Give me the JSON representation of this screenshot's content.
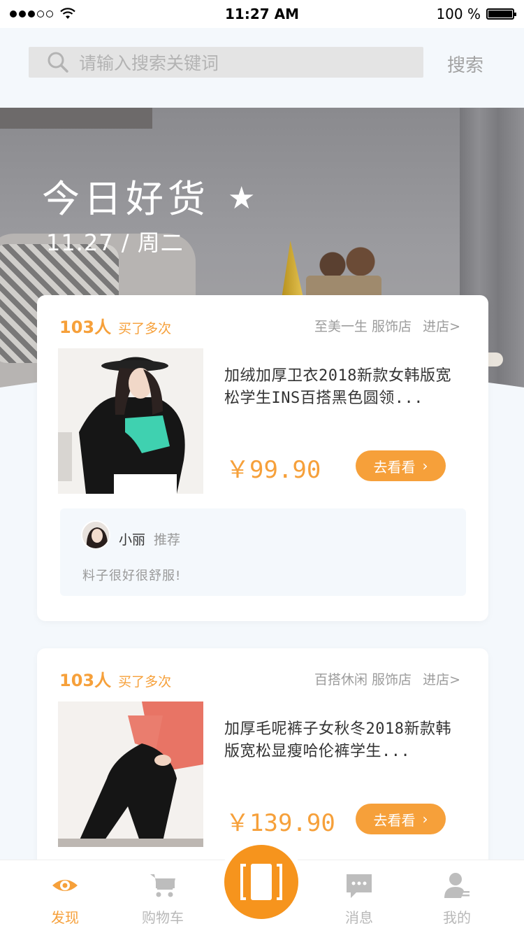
{
  "status": {
    "time": "11:27 AM",
    "battery": "100 %"
  },
  "search": {
    "placeholder": "请输入搜索关键词",
    "button": "搜索"
  },
  "hero": {
    "title": "今日好货",
    "date": "11.27 / 周二"
  },
  "products": [
    {
      "buyers": "103人",
      "buyers_tip": "买了多次",
      "shop": "至美一生 服饰店",
      "enter": "进店>",
      "title": "加绒加厚卫衣2018新款女韩版宽松学生INS百搭黑色圆领...",
      "price": "￥99.90",
      "button": "去看看",
      "recommender": "小丽",
      "recommend_tag": "推荐",
      "comment": "料子很好很舒服!"
    },
    {
      "buyers": "103人",
      "buyers_tip": "买了多次",
      "shop": "百搭休闲 服饰店",
      "enter": "进店>",
      "title": "加厚毛呢裤子女秋冬2018新款韩版宽松显瘦哈伦裤学生...",
      "price": "￥139.90",
      "button": "去看看"
    }
  ],
  "tabs": [
    {
      "label": "发现",
      "icon": "eye-icon",
      "active": true
    },
    {
      "label": "购物车",
      "icon": "cart-icon",
      "active": false
    },
    {
      "label": "消息",
      "icon": "message-icon",
      "active": false
    },
    {
      "label": "我的",
      "icon": "user-icon",
      "active": false
    }
  ],
  "colors": {
    "accent": "#f6a03a",
    "center_button": "#f6941d",
    "background": "#f4f8fc"
  }
}
